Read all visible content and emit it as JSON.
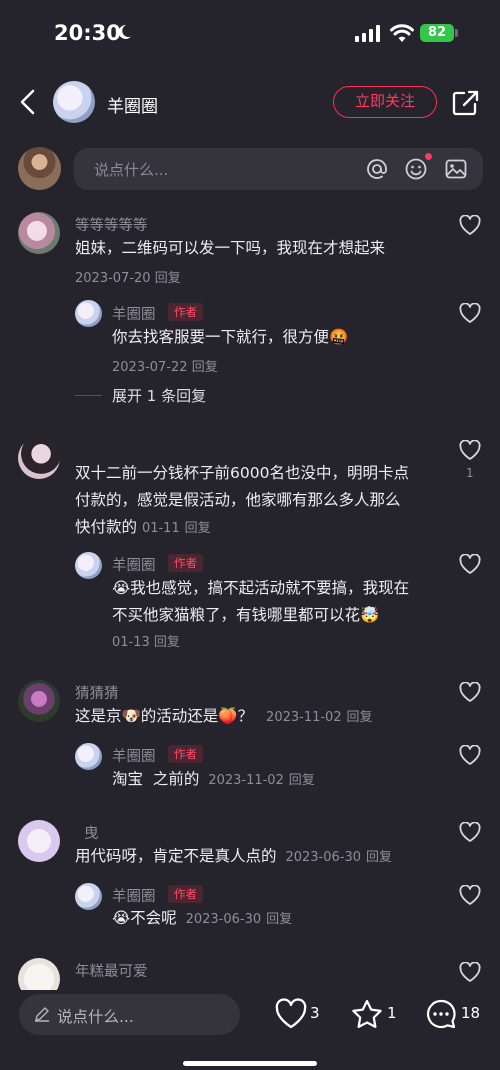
{
  "status_bar": {
    "time": "20:30",
    "battery": "82"
  },
  "header": {
    "author_name": "羊圈圈",
    "follow_label": "立即关注"
  },
  "compose": {
    "placeholder": "说点什么..."
  },
  "comments": [
    {
      "name": "等等等等等",
      "text": "姐妹，二维码可以发一下吗，我现在才想起来",
      "date": "2023-07-20",
      "reply_label": "回复",
      "replies": [
        {
          "name": "羊圈圈",
          "tag": "作者",
          "text": "你去找客服要一下就行，很方便🤬",
          "date": "2023-07-22",
          "reply_label": "回复"
        }
      ],
      "expand_label": "展开 1 条回复"
    },
    {
      "name": "",
      "text_lines": [
        "双十二前一分钱杯子前6000名也没中，明明卡点",
        "付款的，感觉是假活动，他家哪有那么多人那么"
      ],
      "text_last": "快付款的",
      "date": "01-11",
      "reply_label": "回复",
      "likes": "1",
      "replies": [
        {
          "name": "羊圈圈",
          "tag": "作者",
          "text_lines": [
            "😭我也感觉，搞不起活动就不要搞，我现在",
            "不买他家猫粮了，有钱哪里都可以花🤯"
          ],
          "date": "01-13",
          "reply_label": "回复"
        }
      ]
    },
    {
      "name": "猜猜猜",
      "text": "这是京🐶的活动还是🍑？",
      "date": "2023-11-02",
      "reply_label": "回复",
      "replies": [
        {
          "name": "羊圈圈",
          "tag": "作者",
          "text": "淘宝  之前的",
          "date": "2023-11-02",
          "reply_label": "回复"
        }
      ]
    },
    {
      "name": "曳",
      "text": "用代码呀，肯定不是真人点的",
      "date": "2023-06-30",
      "reply_label": "回复",
      "replies": [
        {
          "name": "羊圈圈",
          "tag": "作者",
          "text": "😭不会呢",
          "date": "2023-06-30",
          "reply_label": "回复"
        }
      ]
    },
    {
      "name": "年糕最可爱"
    }
  ],
  "bottom_bar": {
    "placeholder": "说点什么...",
    "likes": "3",
    "favorites": "1",
    "comments": "18"
  },
  "colors": {
    "accent": "#ff2e55",
    "background": "#25232b",
    "input": "#35333c",
    "tag_bg": "#4a2630"
  },
  "icons": [
    "back-arrow-icon",
    "share-icon",
    "at-icon",
    "emoji-icon",
    "image-icon",
    "heart-icon",
    "star-icon",
    "chat-bubble-icon",
    "pencil-icon",
    "moon-icon",
    "wifi-icon",
    "signal-icon"
  ]
}
